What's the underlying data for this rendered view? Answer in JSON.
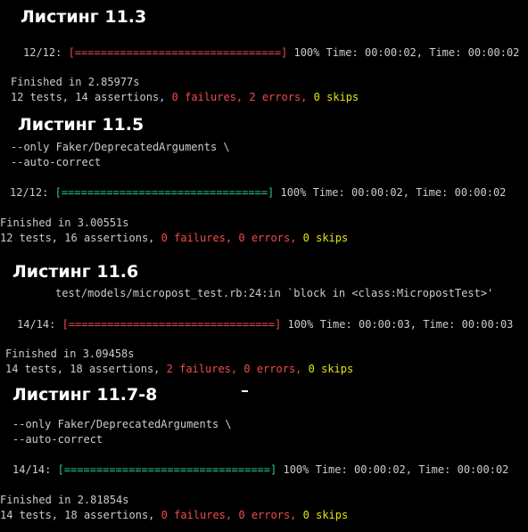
{
  "listing_1": {
    "title": "Листинг 11.3",
    "progress": {
      "count": "12/12:",
      "bar": "[================================]",
      "percent": "100%",
      "time1_label": "Time:",
      "time1": "00:00:02,",
      "time2_label": "Time:",
      "time2": "00:00:02"
    },
    "finished": "Finished in 2.85977s",
    "summary": {
      "tests": "12 tests,",
      "assertions": "14 assertions,",
      "failures": "0 failures,",
      "errors": "2 errors,",
      "skips": "0 skips"
    }
  },
  "listing_2": {
    "title": "Листинг 11.5",
    "command_lines": [
      "--only Faker/DeprecatedArguments \\",
      "--auto-correct"
    ],
    "progress": {
      "count": "12/12:",
      "bar": "[================================]",
      "percent": "100%",
      "time1_label": "Time:",
      "time1": "00:00:02,",
      "time2_label": "Time:",
      "time2": "00:00:02"
    },
    "finished": "Finished in 3.00551s",
    "summary": {
      "tests": "12 tests,",
      "assertions": "16 assertions,",
      "failures": "0 failures,",
      "errors": "0 errors,",
      "skips": "0 skips"
    }
  },
  "listing_3": {
    "title": "Листинг 11.6",
    "trace": "test/models/micropost_test.rb:24:in `block in <class:MicropostTest>'",
    "progress": {
      "count": "14/14:",
      "bar": "[================================]",
      "percent": "100%",
      "time1_label": "Time:",
      "time1": "00:00:03,",
      "time2_label": "Time:",
      "time2": "00:00:03"
    },
    "finished": "Finished in 3.09458s",
    "summary": {
      "tests": "14 tests,",
      "assertions": "18 assertions,",
      "failures": "2 failures,",
      "errors": "0 errors,",
      "skips": "0 skips"
    }
  },
  "listing_4": {
    "title": "Листинг 11.7-8",
    "command_lines": [
      "--only Faker/DeprecatedArguments \\",
      "--auto-correct"
    ],
    "progress": {
      "count": "14/14:",
      "bar": "[================================]",
      "percent": "100%",
      "time1_label": "Time:",
      "time1": "00:00:02,",
      "time2_label": "Time:",
      "time2": "00:00:02"
    },
    "finished": "Finished in 2.81854s",
    "summary": {
      "tests": "14 tests,",
      "assertions": "18 assertions,",
      "failures": "0 failures,",
      "errors": "0 errors,",
      "skips": "0 skips"
    }
  },
  "colors": {
    "background": "#000000",
    "text": "#cccccc",
    "heading": "#ffffff",
    "red": "#f14c4c",
    "green": "#23d18b",
    "yellow": "#e5e510"
  }
}
